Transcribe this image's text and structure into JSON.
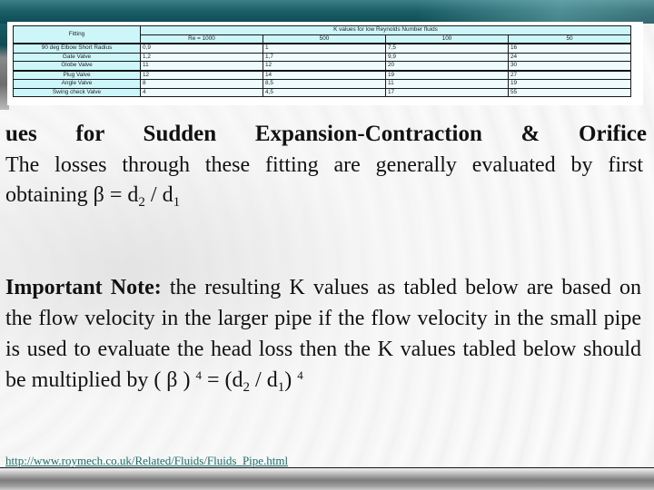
{
  "table": {
    "fitting_header": "Fitting",
    "group_header": "K values for low Reynolds Number fluids",
    "re_columns": [
      "Re = 1000",
      "500",
      "100",
      "50"
    ],
    "rows": [
      {
        "fitting": "90 deg Elbow Short Radius",
        "values": [
          "0,9",
          "1",
          "7,5",
          "16"
        ]
      },
      {
        "fitting": "Gate Valve",
        "values": [
          "1,2",
          "1,7",
          "9,9",
          "24"
        ]
      },
      {
        "fitting": "Globe Valve",
        "values": [
          "11",
          "12",
          "20",
          "30"
        ]
      },
      {
        "fitting": "Plug Valve",
        "values": [
          "12",
          "14",
          "19",
          "27"
        ]
      },
      {
        "fitting": "Angle Valve",
        "values": [
          "8",
          "8,5",
          "11",
          "19"
        ]
      },
      {
        "fitting": "Swing check Valve",
        "values": [
          "4",
          "4,5",
          "17",
          "55"
        ]
      }
    ]
  },
  "heading": "ues for Sudden Expansion-Contraction & Orifice",
  "intro": {
    "line1": "The losses through these fitting are generally evaluated by first",
    "line2_prefix": "obtaining β = d",
    "sub2": "2",
    "slash": " / d",
    "sub1": "1"
  },
  "note": {
    "label": "Important Note:",
    "text": " the resulting K values as tabled below are based on the flow velocity in the larger pipe if the flow velocity in the small pipe is used to evaluate the head loss then the K values tabled below should be multiplied by ( β ) ",
    "exp": "4",
    "eq": " = (d",
    "sub2": "2",
    "slash": " / d",
    "sub1": "1",
    "close": ")",
    "exp2": "4"
  },
  "link": "http://www.roymech.co.uk/Related/Fluids/Fluids_Pipe.html"
}
